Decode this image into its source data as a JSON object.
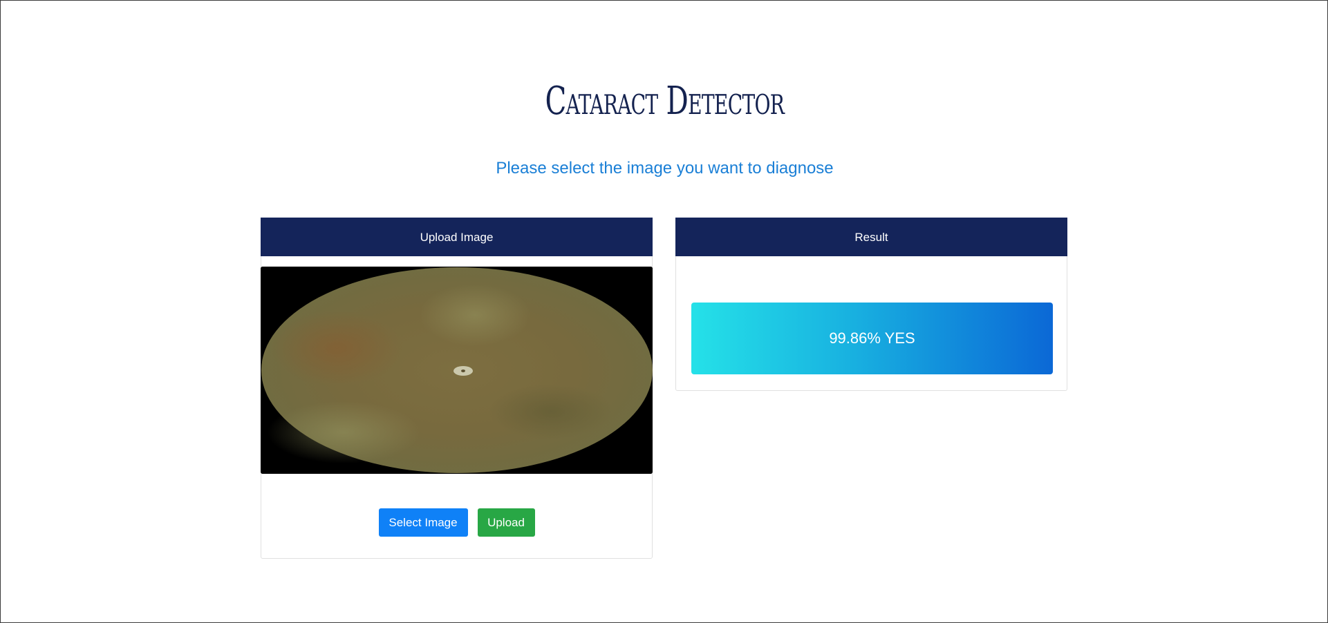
{
  "page": {
    "title": "Cataract Detector",
    "subtitle": "Please select the image you want to diagnose"
  },
  "upload_card": {
    "header": "Upload Image",
    "select_button": "Select Image",
    "upload_button": "Upload"
  },
  "result_card": {
    "header": "Result",
    "result_text": "99.86% YES"
  },
  "colors": {
    "title": "#14224f",
    "subtitle": "#1a7fd6",
    "card_header": "#14245a",
    "select_button": "#0f81f7",
    "upload_button": "#28a745",
    "result_gradient_start": "#25e1e8",
    "result_gradient_end": "#0b68d6"
  }
}
